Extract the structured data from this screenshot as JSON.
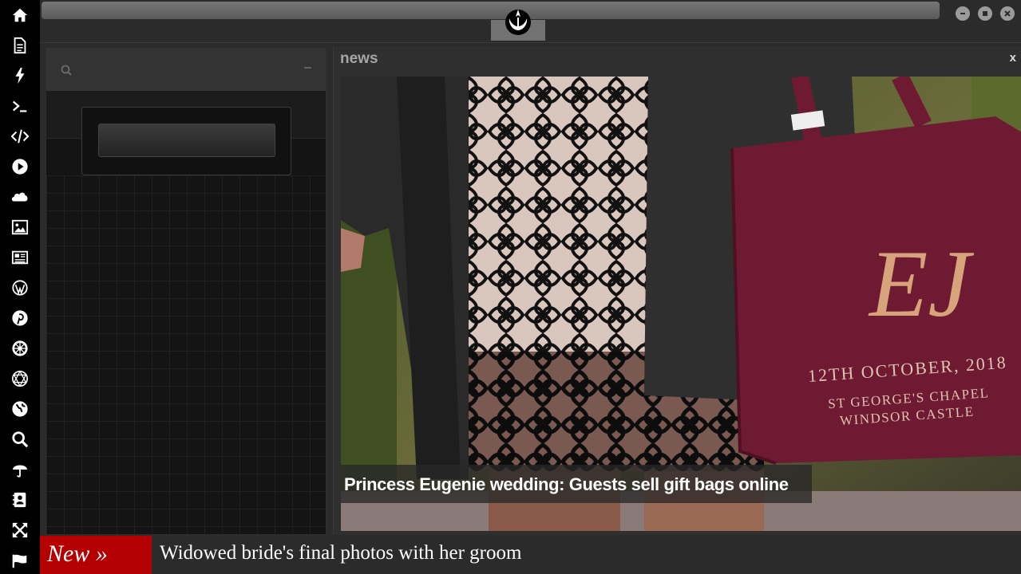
{
  "colors": {
    "rail_bg": "#000000",
    "app_bg": "#2b2b2b",
    "ticker_accent": "#b40000",
    "bag_color": "#6e1a32"
  },
  "rail": {
    "icons": [
      "home-icon",
      "document-icon",
      "lightning-icon",
      "terminal-icon",
      "code-icon",
      "play-icon",
      "cloud-icon",
      "image-icon",
      "newspaper-icon",
      "wordpress-icon",
      "pinterest-icon",
      "galactic-empire-icon",
      "deathstar-icon",
      "globe-icon",
      "search-icon",
      "umbrella-icon",
      "contacts-icon",
      "expand-icon",
      "flag-icon"
    ]
  },
  "topbar": {
    "logo_icon": "rebel-alliance-icon",
    "window_buttons": [
      "minimize-icon",
      "maximize-icon",
      "close-icon"
    ]
  },
  "left_panel": {
    "search_icon": "search-icon",
    "minimize_label": "–"
  },
  "news": {
    "title": "news",
    "close_label": "x",
    "headline": "Princess Eugenie wedding: Guests sell gift bags online",
    "bag_text": {
      "date_line": "12TH OCTOBER, 2018",
      "chapel_line": "ST GEORGE'S CHAPEL",
      "castle_line": "WINDSOR CASTLE",
      "monogram": "EJ"
    }
  },
  "ticker": {
    "label": "New »",
    "text": "Widowed bride's final photos with her groom"
  }
}
